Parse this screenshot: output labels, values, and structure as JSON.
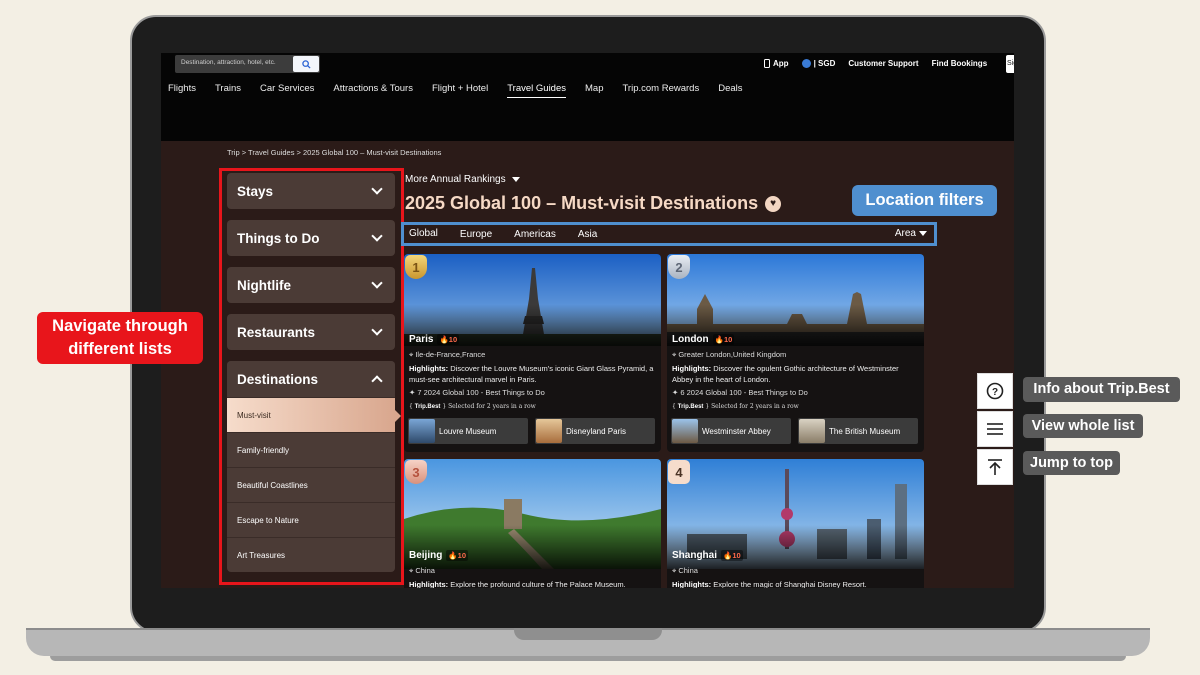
{
  "header": {
    "search_placeholder": "Destination, attraction, hotel, etc.",
    "top_links": {
      "app": "App",
      "currency": "| SGD",
      "support": "Customer Support",
      "bookings": "Find Bookings",
      "signin": "Sig"
    },
    "nav": [
      "Flights",
      "Trains",
      "Car Services",
      "Attractions & Tours",
      "Flight + Hotel",
      "Travel Guides",
      "Map",
      "Trip.com Rewards",
      "Deals"
    ],
    "nav_active": "Travel Guides"
  },
  "breadcrumb": "Trip > Travel Guides > 2025 Global 100 – Must-visit Destinations",
  "sidebar": {
    "sections": [
      "Stays",
      "Things to Do",
      "Nightlife",
      "Restaurants"
    ],
    "open_section": "Destinations",
    "sub_items": [
      "Must-visit",
      "Family-friendly",
      "Beautiful Coastlines",
      "Escape to Nature",
      "Art Treasures"
    ],
    "active_sub": "Must-visit"
  },
  "main": {
    "more_rankings": "More Annual Rankings",
    "title": "2025 Global 100 – Must-visit Destinations",
    "tabs": [
      "Global",
      "Europe",
      "Americas",
      "Asia"
    ],
    "active_tab": "Global",
    "area_label": "Area"
  },
  "cards": [
    {
      "rank": "1",
      "city": "Paris",
      "hot": "🔥10",
      "location": "Ile-de-France,France",
      "highlight_label": "Highlights:",
      "highlight": "Discover the Louvre Museum's iconic Giant Glass Pyramid, a must-see architectural marvel in Paris.",
      "award": "✦ 7 2024 Global 100 - Best Things to Do",
      "badge_brand": "Trip.Best",
      "badge_text": "Selected for 2 years in a row",
      "attractions": [
        "Louvre Museum",
        "Disneyland Paris"
      ]
    },
    {
      "rank": "2",
      "city": "London",
      "hot": "🔥10",
      "location": "Greater London,United Kingdom",
      "highlight_label": "Highlights:",
      "highlight": "Discover the opulent Gothic architecture of Westminster Abbey in the heart of London.",
      "award": "✦ 6 2024 Global 100 - Best Things to Do",
      "badge_brand": "Trip.Best",
      "badge_text": "Selected for 2 years in a row",
      "attractions": [
        "Westminster Abbey",
        "The British Museum"
      ]
    },
    {
      "rank": "3",
      "city": "Beijing",
      "hot": "🔥10",
      "location": "China",
      "highlight_label": "Highlights:",
      "highlight": "Explore the profound culture of The Palace Museum."
    },
    {
      "rank": "4",
      "city": "Shanghai",
      "hot": "🔥10",
      "location": "China",
      "highlight_label": "Highlights:",
      "highlight": "Explore the magic of Shanghai Disney Resort."
    }
  ],
  "callouts": {
    "navigate": "Navigate through\ndifferent lists",
    "location_filters": "Location filters",
    "info": "Info about Trip.Best",
    "view_list": "View whole list",
    "jump_top": "Jump to top"
  },
  "colors": {
    "callout_red": "#e8151b",
    "callout_blue": "#4f8fcf",
    "callout_gray": "#5a5a5a",
    "title_peach": "#f6d9c5"
  },
  "icons": {
    "search": "search-icon",
    "info": "question-circle-icon",
    "list": "hamburger-icon",
    "top": "arrow-up-to-line-icon"
  }
}
